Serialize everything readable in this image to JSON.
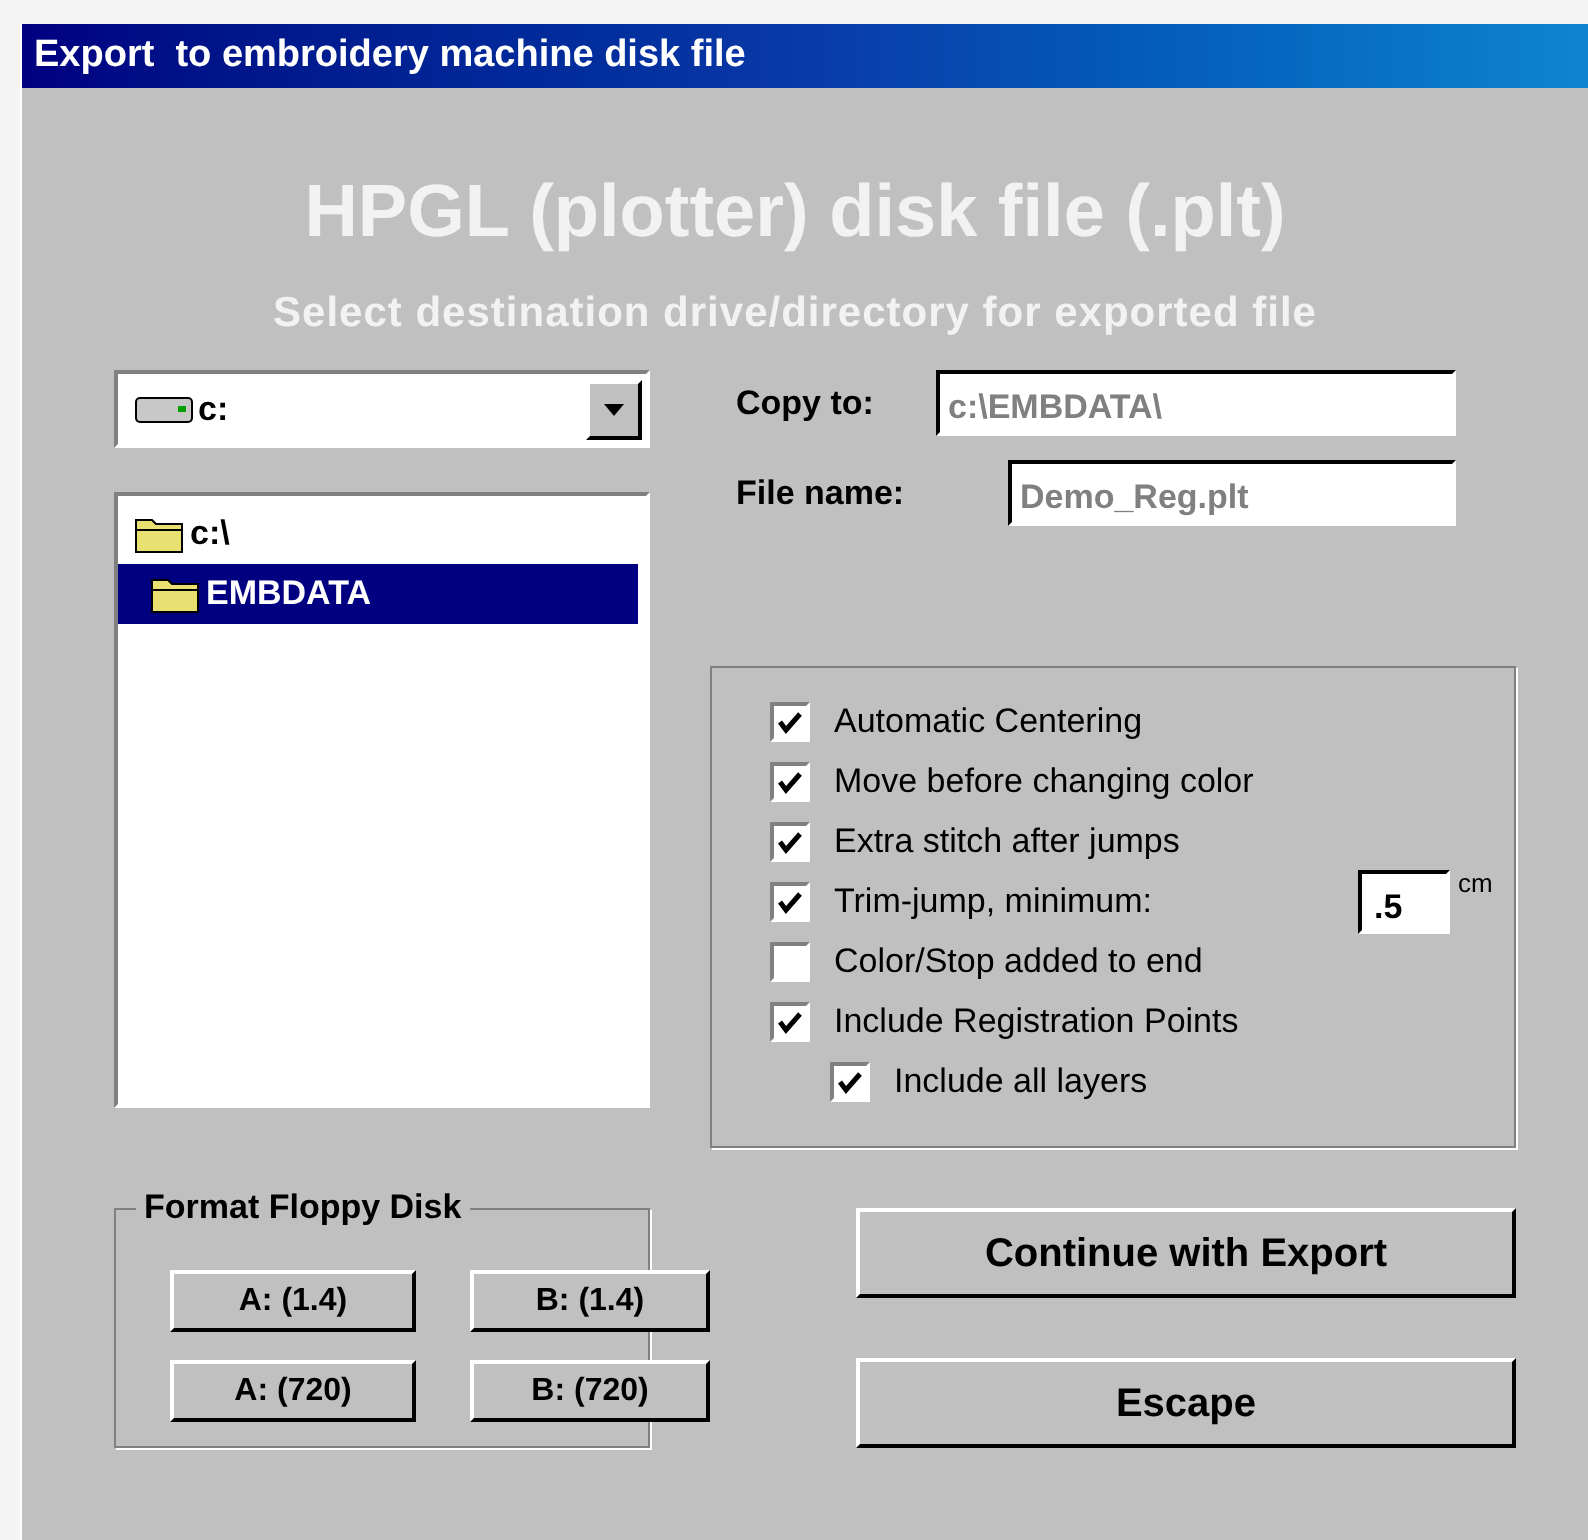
{
  "window": {
    "title": "Export  to embroidery machine disk file"
  },
  "heading": "HPGL (plotter) disk file (.plt)",
  "subtitle": "Select destination drive/directory for exported file",
  "drive": {
    "value": "c:"
  },
  "folders": [
    {
      "label": "c:\\",
      "selected": false,
      "children": [
        {
          "label": "EMBDATA",
          "selected": true
        }
      ]
    }
  ],
  "copy_to": {
    "label": "Copy to:",
    "value": "c:\\EMBDATA\\"
  },
  "file_name": {
    "label": "File name:",
    "value": "Demo_Reg.plt"
  },
  "options": [
    {
      "kind": "checkbox",
      "label": "Automatic Centering",
      "checked": true
    },
    {
      "kind": "checkbox",
      "label": "Move before changing color",
      "checked": true
    },
    {
      "kind": "checkbox",
      "label": "Extra stitch after jumps",
      "checked": true
    },
    {
      "kind": "value",
      "label": "Trim-jump, minimum:",
      "checked": true,
      "value": ".5",
      "unit": "cm"
    },
    {
      "kind": "checkbox",
      "label": "Color/Stop added to end",
      "checked": false
    },
    {
      "kind": "checkbox",
      "label": "Include Registration Points",
      "checked": true,
      "children": [
        {
          "kind": "checkbox",
          "label": "Include all layers",
          "checked": true
        }
      ]
    }
  ],
  "floppy": {
    "title": "Format Floppy Disk",
    "buttons": [
      "A: (1.4)",
      "B: (1.4)",
      "A: (720)",
      "B: (720)"
    ]
  },
  "actions": [
    "Continue with Export",
    "Escape"
  ]
}
